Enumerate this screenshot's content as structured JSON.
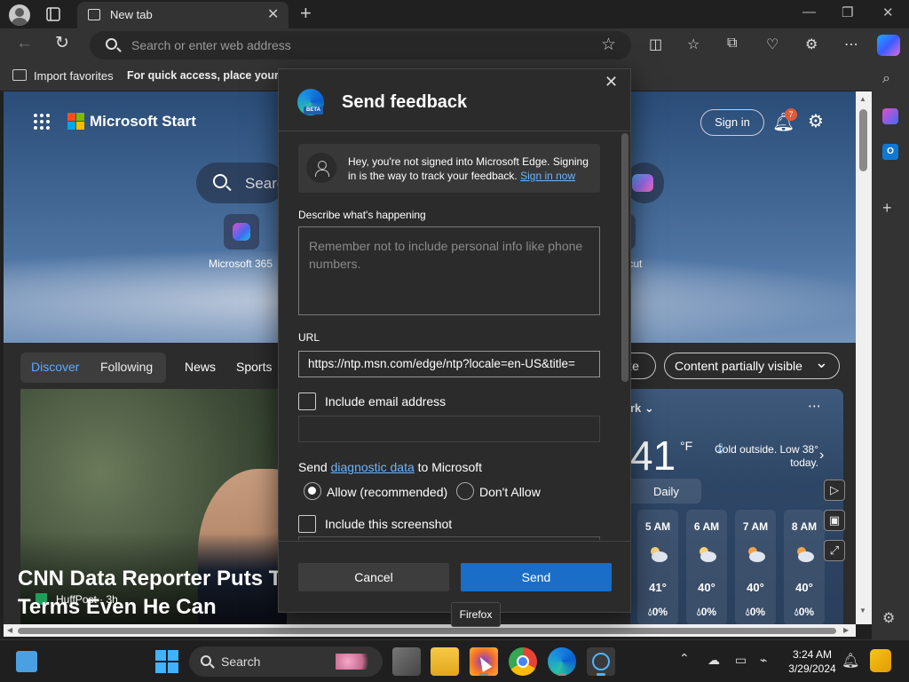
{
  "browser": {
    "tab_title": "New tab",
    "address_placeholder": "Search or enter web address",
    "favorites_bar": {
      "import_label": "Import favorites",
      "hint": "For quick access, place your fav"
    }
  },
  "page": {
    "brand": "Microsoft Start",
    "sign_in": "Sign in",
    "notifications_count": "7",
    "search_placeholder": "Searc",
    "quick_links": [
      {
        "label": "Microsoft 365"
      },
      {
        "label": "tcut"
      }
    ],
    "feed_tabs": [
      "Discover",
      "Following",
      "News",
      "Sports"
    ],
    "personalize_label": "ize",
    "content_visibility": "Content partially visible",
    "hero": {
      "source": "HuffPost · 3h",
      "headline": "CNN Data Reporter Puts T Terms Even He Can Understand"
    },
    "weather": {
      "location": "rk",
      "temperature": "41",
      "unit": "°F",
      "summary": "Cold outside. Low 38° today.",
      "mode": "Daily",
      "hours": [
        {
          "time": "5 AM",
          "temp": "41°",
          "precip": "0%"
        },
        {
          "time": "6 AM",
          "temp": "40°",
          "precip": "0%"
        },
        {
          "time": "7 AM",
          "temp": "40°",
          "precip": "0%"
        },
        {
          "time": "8 AM",
          "temp": "40°",
          "precip": "0%"
        }
      ]
    }
  },
  "feedback_dialog": {
    "title": "Send feedback",
    "beta_badge": "BETA",
    "signin_notice": "Hey, you're not signed into Microsoft Edge. Signing in is the way to track your feedback.",
    "signin_link": "Sign in now",
    "describe_label": "Describe what's happening",
    "describe_placeholder": "Remember not to include personal info like phone numbers.",
    "url_label": "URL",
    "url_value": "https://ntp.msn.com/edge/ntp?locale=en-US&title=",
    "include_email_label": "Include email address",
    "diagnostic_prefix": "Send ",
    "diagnostic_link": "diagnostic data",
    "diagnostic_suffix": " to Microsoft",
    "allow_label": "Allow (recommended)",
    "deny_label": "Don't Allow",
    "include_screenshot_label": "Include this screenshot",
    "cancel_label": "Cancel",
    "send_label": "Send"
  },
  "tooltip": "Firefox",
  "taskbar": {
    "search_label": "Search",
    "time": "3:24 AM",
    "date": "3/29/2024"
  }
}
